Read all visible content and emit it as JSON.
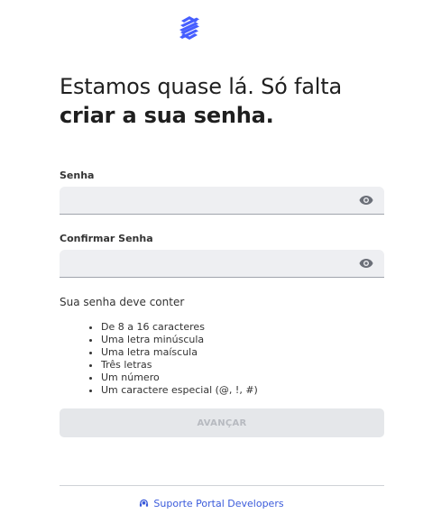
{
  "colors": {
    "brand": "#465EFF",
    "field_bg": "#EEEFF2",
    "button_disabled_bg": "#E5E7EA",
    "link": "#3B5BDB"
  },
  "logo": {
    "icon": "banco-do-brasil-logo"
  },
  "heading": {
    "line1": "Estamos quase lá. Só falta",
    "line2": "criar a sua senha."
  },
  "password": {
    "label": "Senha",
    "value": "",
    "toggle_icon": "eye-icon"
  },
  "confirm_password": {
    "label": "Confirmar Senha",
    "value": "",
    "toggle_icon": "eye-icon"
  },
  "requirements": {
    "title": "Sua senha deve conter",
    "items": [
      "De 8 a 16 caracteres",
      "Uma letra minúscula",
      "Uma letra maíscula",
      "Três letras",
      "Um número",
      "Um caractere especial (@, !, #)"
    ]
  },
  "submit": {
    "label": "AVANÇAR",
    "disabled": true
  },
  "footer": {
    "support_label": "Suporte Portal Developers",
    "support_icon": "headset-icon"
  }
}
